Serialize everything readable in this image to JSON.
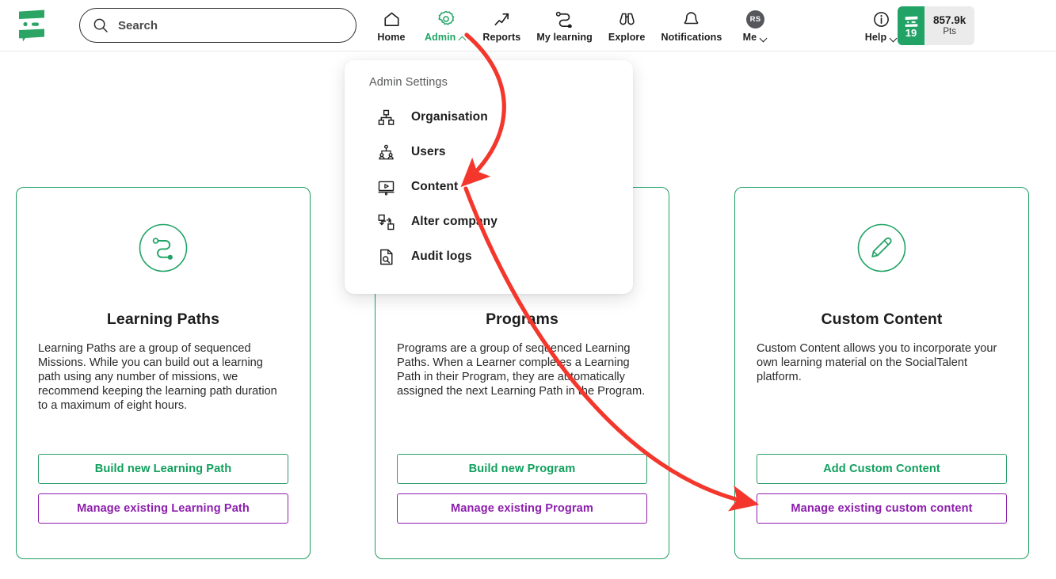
{
  "brand": {
    "logo_icon": "socialtalent-logo-icon"
  },
  "search": {
    "placeholder": "Search",
    "value": "",
    "icon": "search-icon"
  },
  "nav": {
    "items": [
      {
        "label": "Home",
        "icon": "home-icon",
        "active": false,
        "chevron": ""
      },
      {
        "label": "Admin",
        "icon": "gear-icon",
        "active": true,
        "chevron": "up"
      },
      {
        "label": "Reports",
        "icon": "trend-arrow-icon",
        "active": false,
        "chevron": ""
      },
      {
        "label": "My learning",
        "icon": "path-icon",
        "active": false,
        "chevron": ""
      },
      {
        "label": "Explore",
        "icon": "binoculars-icon",
        "active": false,
        "chevron": ""
      },
      {
        "label": "Notifications",
        "icon": "bell-icon",
        "active": false,
        "chevron": ""
      },
      {
        "label": "Me",
        "icon": "avatar-icon",
        "active": false,
        "chevron": "down"
      },
      {
        "label": "Help",
        "icon": "info-circle-icon",
        "active": false,
        "chevron": "down"
      }
    ],
    "me_initials": "RS",
    "points": {
      "level": "19",
      "value": "857.9k",
      "unit": "Pts",
      "badge_color": "#21a366"
    }
  },
  "dropdown": {
    "title": "Admin Settings",
    "items": [
      {
        "label": "Organisation",
        "icon": "org-chart-icon"
      },
      {
        "label": "Users",
        "icon": "users-hierarchy-icon"
      },
      {
        "label": "Content",
        "icon": "video-screen-icon"
      },
      {
        "label": "Alter company",
        "icon": "swap-company-icon"
      },
      {
        "label": "Audit logs",
        "icon": "document-search-icon"
      }
    ]
  },
  "cards": [
    {
      "icon": "learning-path-circle-icon",
      "title": "Learning Paths",
      "description": "Learning Paths are a group of sequenced Missions. While you can build out a learning path using any number of missions, we recommend keeping the learning path duration to a maximum of eight hours.",
      "primary_button": "Build new Learning Path",
      "secondary_button": "Manage existing Learning Path"
    },
    {
      "icon": "programs-circle-icon",
      "title": "Programs",
      "description": "Programs are a group of sequenced Learning Paths. When a Learner completes a Learning Path in their Program, they are automatically assigned the next Learning Path in the Program.",
      "primary_button": "Build new Program",
      "secondary_button": "Manage existing Program"
    },
    {
      "icon": "pencil-circle-icon",
      "title": "Custom Content",
      "description": "Custom Content allows you to incorporate your own learning material on the SocialTalent platform.",
      "primary_button": "Add Custom Content",
      "secondary_button": "Manage existing custom content"
    }
  ],
  "annotations": {
    "color": "#f4372c",
    "arrow_1": {
      "from": "Admin nav item",
      "to": "Content menu item"
    },
    "arrow_2": {
      "from": "Content menu item",
      "to": "Manage existing custom content button"
    }
  },
  "colors": {
    "accent_green": "#21a366",
    "card_border_green": "#1f9e62",
    "button_purple": "#8d1fad",
    "annotation_red": "#f4372c",
    "text_dark": "#1d1d1d"
  }
}
